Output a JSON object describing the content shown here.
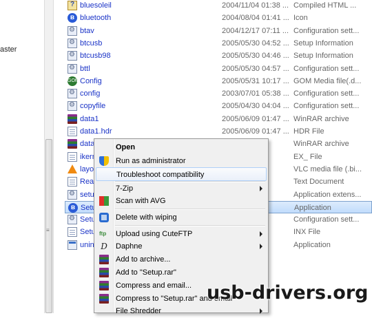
{
  "left_pane": {
    "partial_label": "aster"
  },
  "files": [
    {
      "name": "bluesoleil",
      "date": "2004/11/04 01:38 ...",
      "type": "Compiled HTML ...",
      "icon": "chm-icon"
    },
    {
      "name": "bluetooth",
      "date": "2004/08/04 01:41 ...",
      "type": "Icon",
      "icon": "bluetooth-icon"
    },
    {
      "name": "btav",
      "date": "2004/12/17 07:11 ...",
      "type": "Configuration sett...",
      "icon": "config-file-icon"
    },
    {
      "name": "btcusb",
      "date": "2005/05/30 04:52 ...",
      "type": "Setup Information",
      "icon": "config-file-icon"
    },
    {
      "name": "btcusb98",
      "date": "2005/05/30 04:46 ...",
      "type": "Setup Information",
      "icon": "config-file-icon"
    },
    {
      "name": "bttl",
      "date": "2005/05/30 04:57 ...",
      "type": "Configuration sett...",
      "icon": "config-file-icon"
    },
    {
      "name": "Config",
      "date": "2005/05/31 10:17 ...",
      "type": "GOM Media file(.d...",
      "icon": "gom-icon"
    },
    {
      "name": "config",
      "date": "2003/07/01 05:38 ...",
      "type": "Configuration sett...",
      "icon": "config-file-icon"
    },
    {
      "name": "copyfile",
      "date": "2005/04/30 04:04 ...",
      "type": "Configuration sett...",
      "icon": "config-file-icon"
    },
    {
      "name": "data1",
      "date": "2005/06/09 01:47 ...",
      "type": "WinRAR archive",
      "icon": "winrar-icon"
    },
    {
      "name": "data1.hdr",
      "date": "2005/06/09 01:47 ...",
      "type": "HDR File",
      "icon": "document-icon"
    },
    {
      "name": "data2",
      "date": "07 ...",
      "type": "WinRAR archive",
      "icon": "winrar-icon"
    },
    {
      "name": "ikern",
      "date": "07 ...",
      "type": "EX_ File",
      "icon": "document-icon"
    },
    {
      "name": "layou",
      "date": "47 ...",
      "type": "VLC media file (.bi...",
      "icon": "vlc-icon"
    },
    {
      "name": "Read",
      "date": "04 ...",
      "type": "Text Document",
      "icon": "document-icon"
    },
    {
      "name": "setup",
      "date": "12 ...",
      "type": "Application extens...",
      "icon": "config-file-icon"
    },
    {
      "name": "Setup",
      "date": "48 ...",
      "type": "Application",
      "icon": "bluetooth-icon",
      "selected": true
    },
    {
      "name": "Setup",
      "date": "49 ...",
      "type": "Configuration sett...",
      "icon": "config-file-icon"
    },
    {
      "name": "Setup",
      "date": "46 ...",
      "type": "INX File",
      "icon": "document-icon"
    },
    {
      "name": "unin",
      "date": "54 ...",
      "type": "Application",
      "icon": "app-icon"
    }
  ],
  "context_menu": {
    "open": "Open",
    "run_as_admin": "Run as administrator",
    "troubleshoot": "Troubleshoot compatibility",
    "seven_zip": "7-Zip",
    "scan_avg": "Scan with AVG",
    "delete_wiping": "Delete with wiping",
    "upload_cuteftp": "Upload using CuteFTP",
    "daphne": "Daphne",
    "add_archive": "Add to archive...",
    "add_setup_rar": "Add to \"Setup.rar\"",
    "compress_email": "Compress and email...",
    "compress_setup_rar_email": "Compress to \"Setup.rar\" and email",
    "file_shredder": "File Shredder"
  },
  "watermark": "usb-drivers.org",
  "colors": {
    "link_blue": "#1a33c7",
    "selection": "#c1dcfc",
    "menu_bg": "#f0f0f0",
    "highlight_border": "#aecff7"
  }
}
